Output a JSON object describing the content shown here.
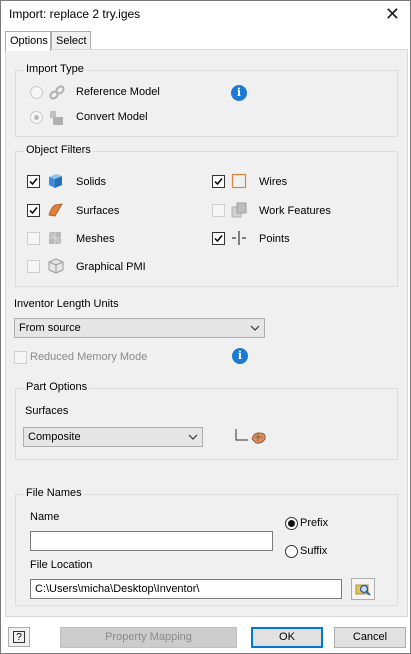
{
  "window": {
    "title": "Import:  replace 2 try.iges",
    "close_glyph": "✕"
  },
  "tabs": [
    {
      "label": "Options"
    },
    {
      "label": "Select"
    }
  ],
  "import_type": {
    "legend": "Import Type",
    "reference_model": "Reference Model",
    "convert_model": "Convert Model",
    "selected": "Convert Model"
  },
  "object_filters": {
    "legend": "Object Filters",
    "items": [
      {
        "label": "Solids",
        "checked": true,
        "enabled": true,
        "icon": "solid-cube-icon"
      },
      {
        "label": "Surfaces",
        "checked": true,
        "enabled": true,
        "icon": "surface-icon"
      },
      {
        "label": "Meshes",
        "checked": false,
        "enabled": false,
        "icon": "mesh-icon"
      },
      {
        "label": "Graphical PMI",
        "checked": false,
        "enabled": false,
        "icon": "graphical-pmi-icon"
      },
      {
        "label": "Wires",
        "checked": true,
        "enabled": true,
        "icon": "wire-icon"
      },
      {
        "label": "Work Features",
        "checked": false,
        "enabled": false,
        "icon": "work-feature-icon"
      },
      {
        "label": "Points",
        "checked": true,
        "enabled": true,
        "icon": "point-icon"
      }
    ]
  },
  "length_units": {
    "label": "Inventor Length Units",
    "value": "From source"
  },
  "reduced_memory": {
    "label": "Reduced Memory Mode",
    "checked": false,
    "enabled": false
  },
  "part_options": {
    "legend": "Part Options",
    "surfaces_label": "Surfaces",
    "surfaces_value": "Composite"
  },
  "file_names": {
    "legend": "File Names",
    "name_label": "Name",
    "name_value": "",
    "prefix_label": "Prefix",
    "suffix_label": "Suffix",
    "selected": "Prefix",
    "location_label": "File Location",
    "location_value": "C:\\Users\\micha\\Desktop\\Inventor\\"
  },
  "footer": {
    "help_glyph": "?",
    "property_mapping": "Property Mapping",
    "ok": "OK",
    "cancel": "Cancel"
  },
  "info_glyph": "i",
  "colors": {
    "accent": "#0078d7",
    "info": "#1a7ad4",
    "surface_orange": "#e0803a",
    "solid_blue": "#3a8fd8"
  }
}
